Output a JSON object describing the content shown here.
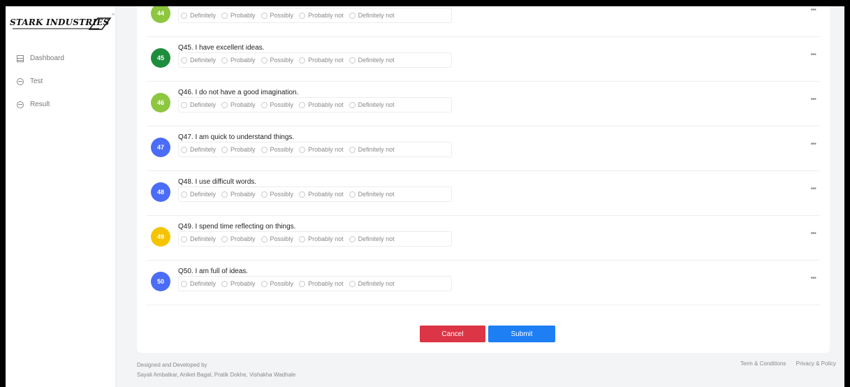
{
  "sidebar": {
    "logo_text": "STARK INDUSTRIES",
    "items": [
      {
        "label": "Dashboard"
      },
      {
        "label": "Test"
      },
      {
        "label": "Result"
      }
    ]
  },
  "options": [
    "Definitely",
    "Probably",
    "Possibly",
    "Probably not",
    "Definitely not"
  ],
  "questions": [
    {
      "number": "44",
      "text": "",
      "color": "#8dc63f"
    },
    {
      "number": "45",
      "text": "Q45. I have excellent ideas.",
      "color": "#1e8e3e"
    },
    {
      "number": "46",
      "text": "Q46. I do not have a good imagination.",
      "color": "#8dc63f"
    },
    {
      "number": "47",
      "text": "Q47. I am quick to understand things.",
      "color": "#4a6cf7"
    },
    {
      "number": "48",
      "text": "Q48. I use difficult words.",
      "color": "#4a6cf7"
    },
    {
      "number": "49",
      "text": "Q49. I spend time reflecting on things.",
      "color": "#f5c400"
    },
    {
      "number": "50",
      "text": "Q50. I am full of ideas.",
      "color": "#4a6cf7"
    }
  ],
  "more_label": "•••",
  "buttons": {
    "cancel": "Cancel",
    "submit": "Submit"
  },
  "footer": {
    "line1": "Designed and Developed by",
    "line2": "Sayali Ambatkar, Aniket Bagal, Pratik Dokhe, Vishakha Wadhale",
    "links": [
      "Term & Conditions",
      "Privacy & Policy"
    ]
  }
}
